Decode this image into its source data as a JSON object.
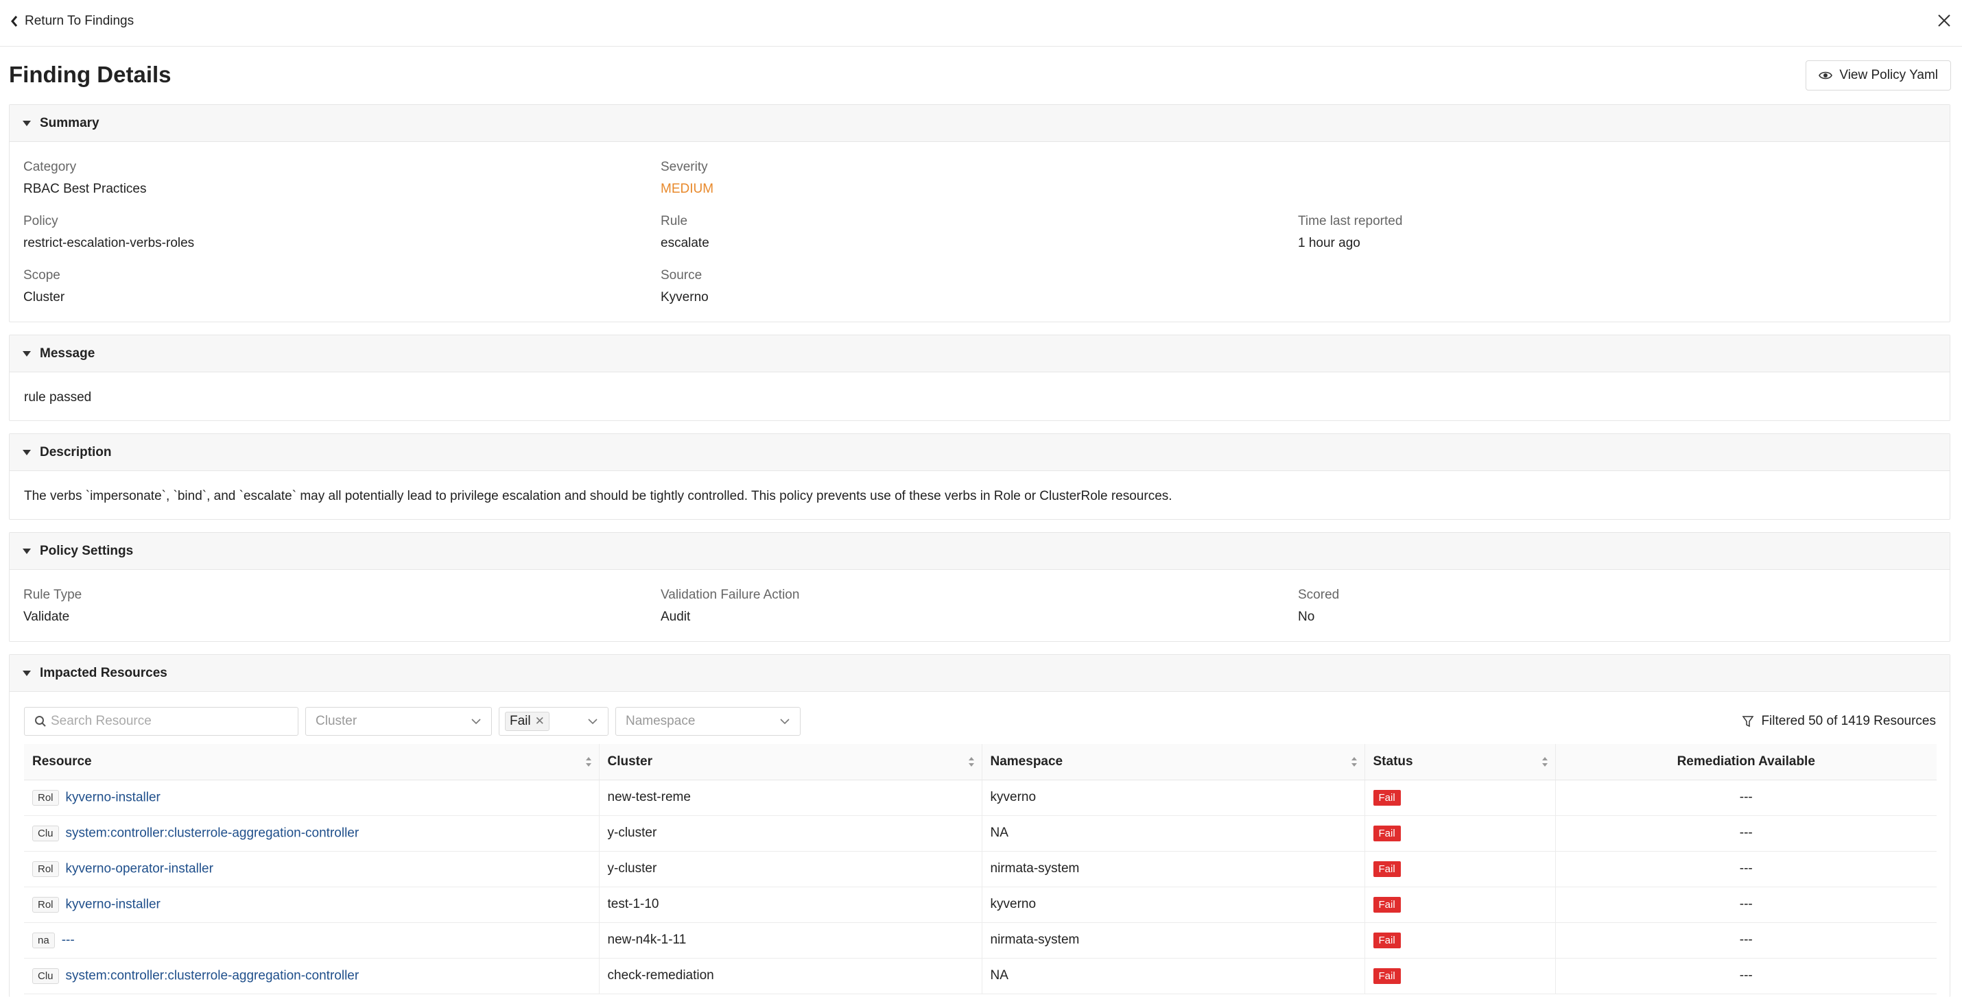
{
  "nav": {
    "back_label": "Return To Findings"
  },
  "page": {
    "title": "Finding Details",
    "view_yaml_label": "View Policy Yaml"
  },
  "summary": {
    "heading": "Summary",
    "category_label": "Category",
    "category_value": "RBAC Best Practices",
    "severity_label": "Severity",
    "severity_value": "MEDIUM",
    "policy_label": "Policy",
    "policy_value": "restrict-escalation-verbs-roles",
    "rule_label": "Rule",
    "rule_value": "escalate",
    "time_label": "Time last reported",
    "time_value": "1 hour ago",
    "scope_label": "Scope",
    "scope_value": "Cluster",
    "source_label": "Source",
    "source_value": "Kyverno"
  },
  "message": {
    "heading": "Message",
    "text": "rule passed"
  },
  "description": {
    "heading": "Description",
    "text": "The verbs `impersonate`, `bind`, and `escalate` may all potentially lead to privilege escalation and should be tightly controlled. This policy prevents use of these verbs in Role or ClusterRole resources."
  },
  "policy_settings": {
    "heading": "Policy Settings",
    "rule_type_label": "Rule Type",
    "rule_type_value": "Validate",
    "vfa_label": "Validation Failure Action",
    "vfa_value": "Audit",
    "scored_label": "Scored",
    "scored_value": "No"
  },
  "impacted": {
    "heading": "Impacted Resources",
    "search_placeholder": "Search Resource",
    "cluster_placeholder": "Cluster",
    "status_tag": "Fail",
    "namespace_placeholder": "Namespace",
    "filtered_text": "Filtered 50 of 1419 Resources",
    "columns": [
      "Resource",
      "Cluster",
      "Namespace",
      "Status",
      "Remediation Available"
    ],
    "rows": [
      {
        "kind": "Rol",
        "name": "kyverno-installer",
        "cluster": "new-test-reme",
        "namespace": "kyverno",
        "status": "Fail",
        "remediation": "---"
      },
      {
        "kind": "Clu",
        "name": "system:controller:clusterrole-aggregation-controller",
        "cluster": "y-cluster",
        "namespace": "NA",
        "status": "Fail",
        "remediation": "---"
      },
      {
        "kind": "Rol",
        "name": "kyverno-operator-installer",
        "cluster": "y-cluster",
        "namespace": "nirmata-system",
        "status": "Fail",
        "remediation": "---"
      },
      {
        "kind": "Rol",
        "name": "kyverno-installer",
        "cluster": "test-1-10",
        "namespace": "kyverno",
        "status": "Fail",
        "remediation": "---"
      },
      {
        "kind": "na",
        "name": "---",
        "cluster": "new-n4k-1-11",
        "namespace": "nirmata-system",
        "status": "Fail",
        "remediation": "---"
      },
      {
        "kind": "Clu",
        "name": "system:controller:clusterrole-aggregation-controller",
        "cluster": "check-remediation",
        "namespace": "NA",
        "status": "Fail",
        "remediation": "---"
      }
    ]
  },
  "colors": {
    "severity_medium": "#e8892b",
    "fail_badge": "#e02d2d",
    "link": "#1f4f8b"
  }
}
